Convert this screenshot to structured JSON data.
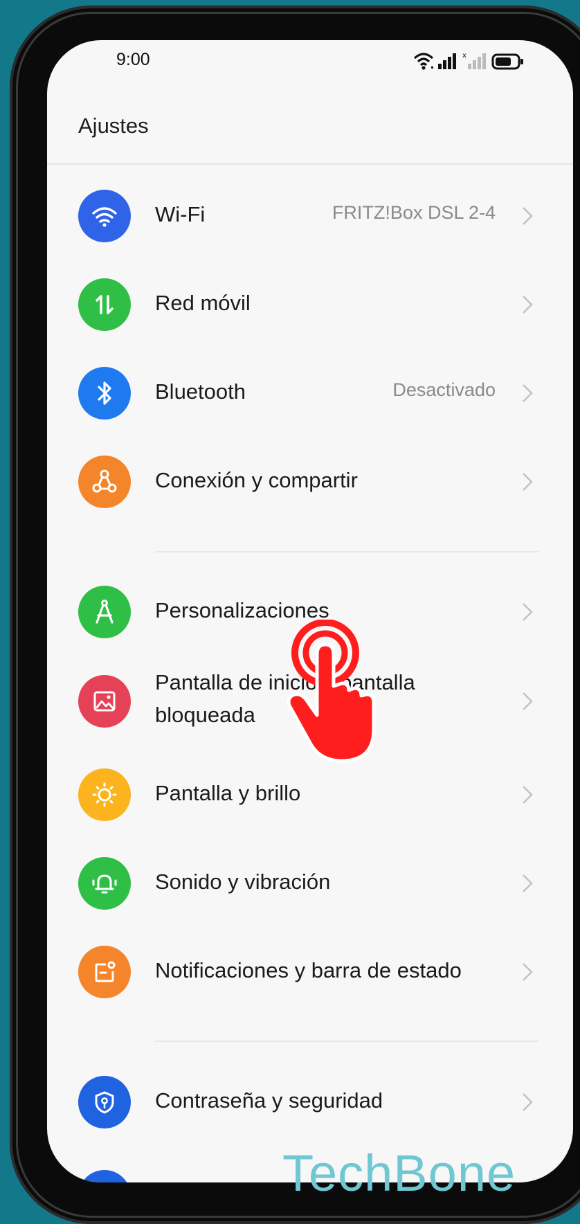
{
  "status_bar": {
    "time": "9:00"
  },
  "header": {
    "title": "Ajustes"
  },
  "rows": [
    {
      "label": "Wi-Fi",
      "value": "FRITZ!Box DSL 2-4",
      "icon": "wifi-icon",
      "color": "#2f63e8"
    },
    {
      "label": "Red móvil",
      "value": "",
      "icon": "mobile-data-icon",
      "color": "#2fbf47"
    },
    {
      "label": "Bluetooth",
      "value": "Desactivado",
      "icon": "bluetooth-icon",
      "color": "#1f7af0"
    },
    {
      "label": "Conexión y compartir",
      "value": "",
      "icon": "share-icon",
      "color": "#f5852b"
    },
    {
      "label": "Personalizaciones",
      "value": "",
      "icon": "compass-icon",
      "color": "#2fbf47"
    },
    {
      "label_line1": "Pantalla de inicio y pantalla",
      "label_line2": "bloqueada",
      "value": "",
      "icon": "image-icon",
      "color": "#e64257"
    },
    {
      "label": "Pantalla y brillo",
      "value": "",
      "icon": "sun-icon",
      "color": "#fbb41d"
    },
    {
      "label": "Sonido y vibración",
      "value": "",
      "icon": "bell-icon",
      "color": "#2fbf47"
    },
    {
      "label": "Notificaciones y barra de estado",
      "value": "",
      "icon": "notification-icon",
      "color": "#f5852b"
    },
    {
      "label": "Contraseña y seguridad",
      "value": "",
      "icon": "shield-icon",
      "color": "#1f63e0"
    }
  ],
  "watermark": "TechBone"
}
